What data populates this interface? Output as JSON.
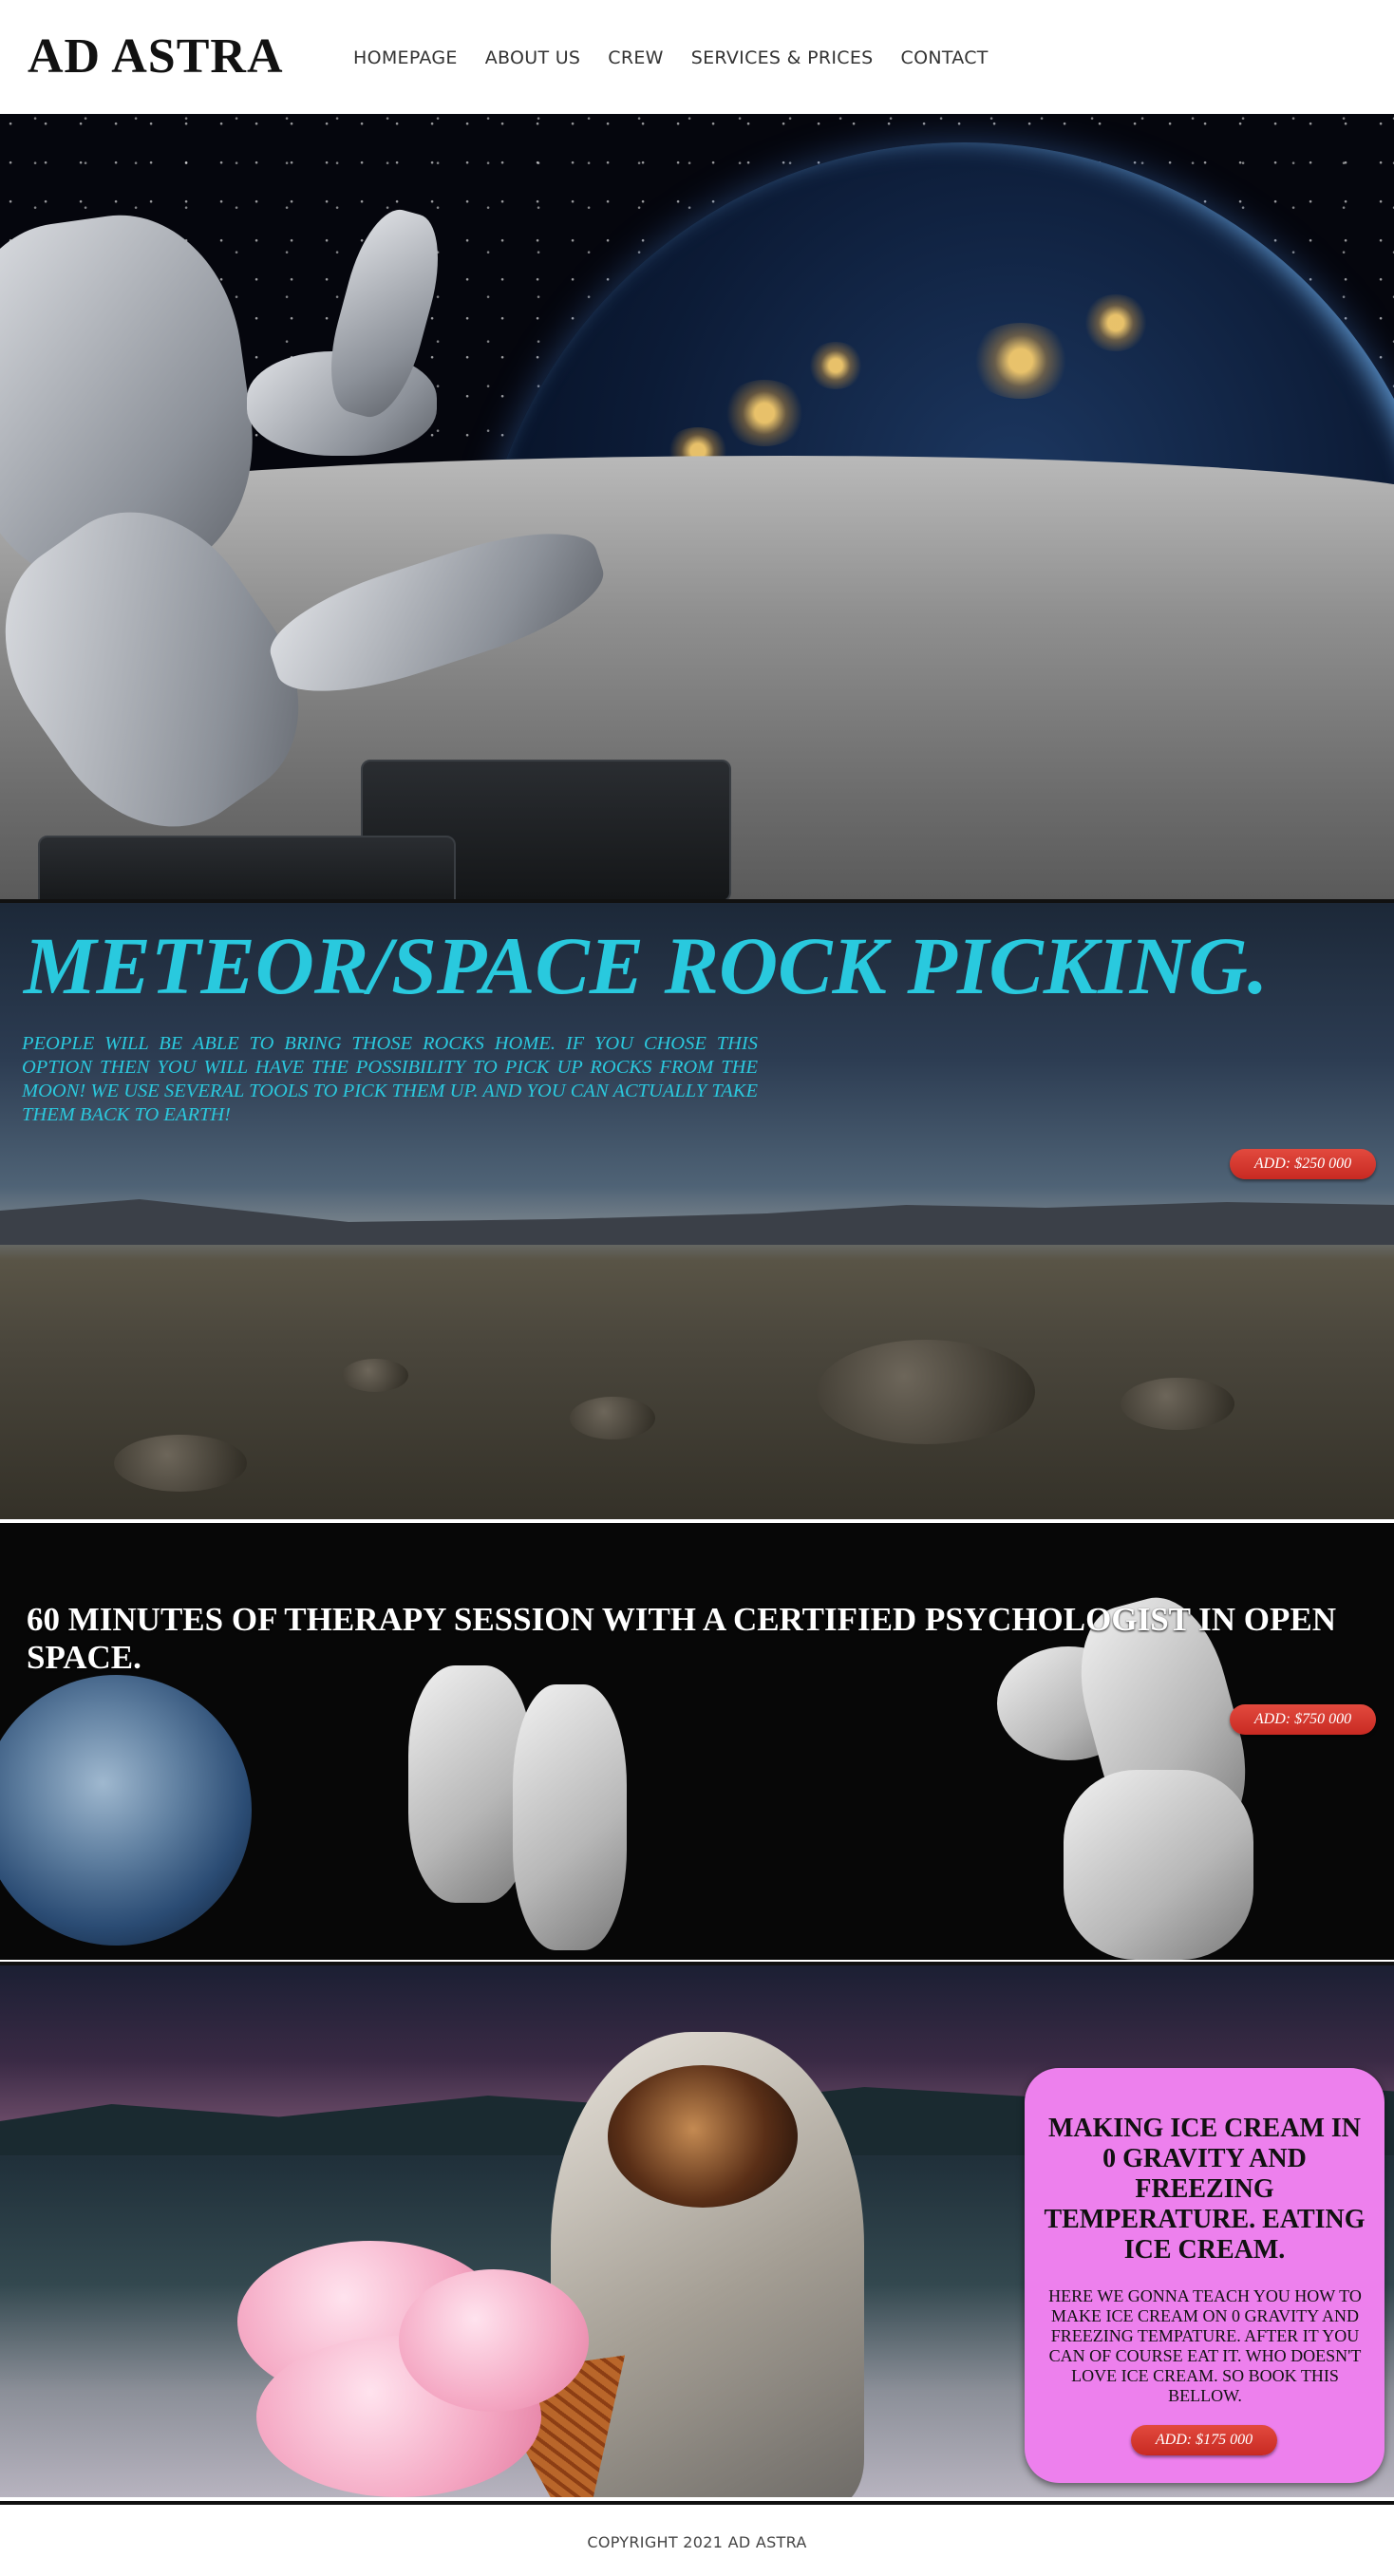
{
  "header": {
    "logo": "AD ASTRA",
    "nav": [
      "HOMEPAGE",
      "ABOUT US",
      "CREW",
      "SERVICES & PRICES",
      "CONTACT"
    ]
  },
  "rock_section": {
    "title": "METEOR/SPACE ROCK PICKING.",
    "text": "PEOPLE WILL BE ABLE TO BRING THOSE ROCKS HOME. IF YOU CHOSE THIS OPTION THEN YOU WILL HAVE THE POSSIBILITY TO PICK UP ROCKS FROM THE MOON! WE USE SEVERAL TOOLS TO PICK THEM UP. AND YOU CAN ACTUALLY TAKE THEM BACK TO EARTH!",
    "button": "ADD: $250 000"
  },
  "therapy_section": {
    "title": "60 MINUTES OF THERAPY SESSION WITH A CERTIFIED PSYCHOLOGIST IN OPEN SPACE.",
    "button": "ADD: $750 000"
  },
  "ice_section": {
    "title": "MAKING ICE CREAM IN 0 GRAVITY AND FREEZING TEMPERATURE. EATING ICE CREAM.",
    "text": "HERE WE GONNA TEACH YOU HOW TO MAKE ICE CREAM ON 0 GRAVITY AND FREEZING TEMPATURE. AFTER IT YOU CAN OF COURSE EAT IT. WHO DOESN'T LOVE ICE CREAM. SO BOOK THIS BELLOW.",
    "button": "ADD: $175 000",
    "card_color": "#ed80ed"
  },
  "footer": {
    "copyright": "COPYRIGHT 2021 AD ASTRA"
  },
  "colors": {
    "accent_cyan": "#29c9de",
    "button_red": "#d2332a"
  }
}
